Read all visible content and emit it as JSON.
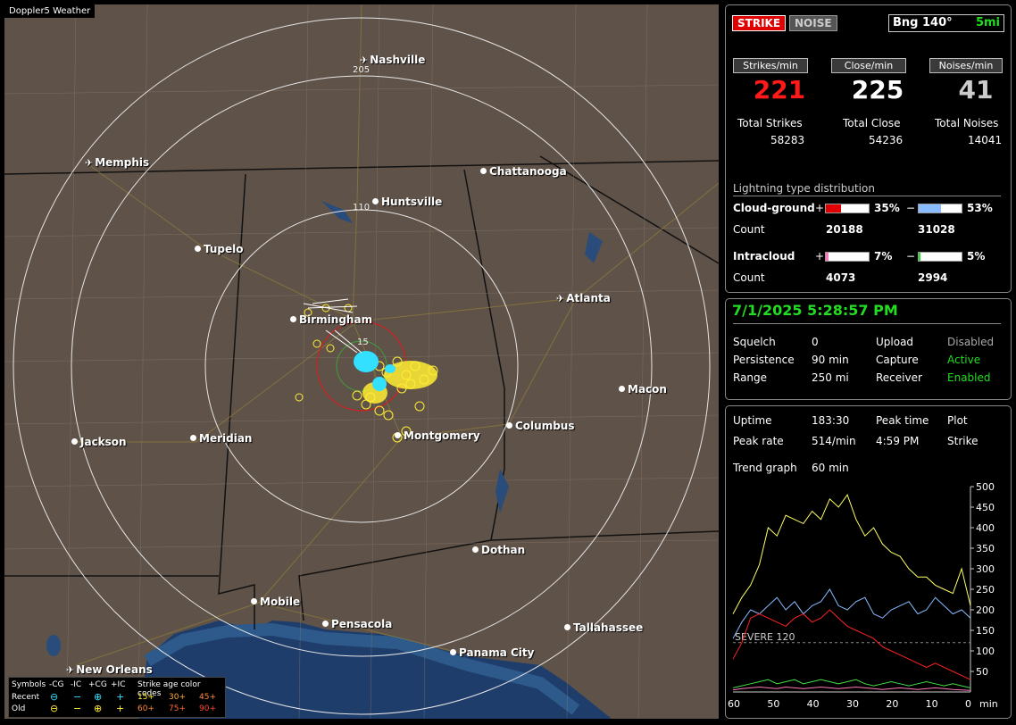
{
  "window_title": "Doppler5 Weather",
  "map": {
    "cities": [
      {
        "name": "Nashville",
        "type": "plane"
      },
      {
        "name": "Memphis",
        "type": "plane"
      },
      {
        "name": "Chattanooga",
        "type": "dot"
      },
      {
        "name": "Huntsville",
        "type": "dot"
      },
      {
        "name": "Tupelo",
        "type": "dot"
      },
      {
        "name": "Atlanta",
        "type": "plane"
      },
      {
        "name": "Birmingham",
        "type": "dot"
      },
      {
        "name": "Macon",
        "type": "dot"
      },
      {
        "name": "Jackson",
        "type": "dot"
      },
      {
        "name": "Meridian",
        "type": "dot"
      },
      {
        "name": "Montgomery",
        "type": "dot"
      },
      {
        "name": "Columbus",
        "type": "dot"
      },
      {
        "name": "Dothan",
        "type": "dot"
      },
      {
        "name": "Mobile",
        "type": "dot"
      },
      {
        "name": "Pensacola",
        "type": "dot"
      },
      {
        "name": "Tallahassee",
        "type": "dot"
      },
      {
        "name": "Panama City",
        "type": "dot"
      },
      {
        "name": "New Orleans",
        "type": "plane"
      }
    ],
    "ring_labels": [
      "205",
      "110",
      "15"
    ]
  },
  "legend": {
    "symbols_label": "Symbols",
    "cols": [
      "-CG",
      "-IC",
      "+CG",
      "+IC"
    ],
    "age_label": "Strike age color codes",
    "recent": "Recent",
    "old": "Old",
    "recent_ages": [
      "15+",
      "30+",
      "45+"
    ],
    "old_ages": [
      "60+",
      "75+",
      "90+"
    ],
    "recent_symbols": [
      "⊖",
      "−",
      "⊕",
      "+"
    ],
    "old_symbols": [
      "⊖",
      "−",
      "⊕",
      "+"
    ]
  },
  "status": {
    "strike_btn": "STRIKE",
    "noise_btn": "NOISE",
    "bearing": "Bng 140°",
    "distance": "5mi",
    "strikes_min_label": "Strikes/min",
    "close_min_label": "Close/min",
    "noises_min_label": "Noises/min",
    "strikes_min": "221",
    "close_min": "225",
    "noises_min": "41",
    "total_strikes_label": "Total Strikes",
    "total_close_label": "Total Close",
    "total_noises_label": "Total Noises",
    "total_strikes": "58283",
    "total_close": "54236",
    "total_noises": "14041",
    "dist_title": "Lightning type distribution",
    "cg_label": "Cloud-ground",
    "ic_label": "Intracloud",
    "count_label": "Count",
    "plus": "+",
    "minus": "−",
    "cg_pos_pct": "35%",
    "cg_neg_pct": "53%",
    "ic_pos_pct": "7%",
    "ic_neg_pct": "5%",
    "cg_pos_count": "20188",
    "cg_neg_count": "31028",
    "ic_pos_count": "4073",
    "ic_neg_count": "2994",
    "cg_pos_level": 0.35,
    "cg_neg_level": 0.53,
    "ic_pos_level": 0.07,
    "ic_neg_level": 0.05
  },
  "settings": {
    "datetime": "7/1/2025 5:28:57 PM",
    "squelch_label": "Squelch",
    "squelch": "0",
    "persistence_label": "Persistence",
    "persistence": "90 min",
    "range_label": "Range",
    "range": "250 mi",
    "upload_label": "Upload",
    "upload": "Disabled",
    "capture_label": "Capture",
    "capture": "Active",
    "receiver_label": "Receiver",
    "receiver": "Enabled"
  },
  "trend": {
    "uptime_label": "Uptime",
    "uptime": "183:30",
    "peak_time_label": "Peak time",
    "peak_time": "4:59 PM",
    "plot_label": "Plot",
    "plot": "Strike",
    "peak_rate_label": "Peak rate",
    "peak_rate": "514/min",
    "trend_graph_label": "Trend graph",
    "trend_graph": "60 min",
    "severe_label": "SEVERE 120",
    "x_ticks": [
      "60",
      "50",
      "40",
      "30",
      "20",
      "10",
      "0"
    ],
    "x_unit": "min",
    "y_ticks": [
      "500",
      "450",
      "400",
      "350",
      "300",
      "250",
      "200",
      "150",
      "100",
      "50"
    ]
  },
  "chart_data": {
    "type": "line",
    "xlabel": "min",
    "ylim": [
      0,
      500
    ],
    "xlim": [
      60,
      0
    ],
    "threshold": 120,
    "series": [
      {
        "color": "#ffff66",
        "values": [
          190,
          230,
          260,
          310,
          400,
          380,
          430,
          420,
          410,
          440,
          420,
          470,
          450,
          480,
          420,
          380,
          400,
          360,
          340,
          330,
          300,
          280,
          280,
          260,
          250,
          240,
          300,
          210
        ]
      },
      {
        "color": "#88bbff",
        "values": [
          130,
          170,
          200,
          190,
          210,
          230,
          200,
          220,
          190,
          210,
          220,
          250,
          210,
          200,
          220,
          230,
          190,
          180,
          200,
          210,
          220,
          190,
          200,
          230,
          210,
          190,
          200,
          180
        ]
      },
      {
        "color": "#ff2222",
        "values": [
          80,
          120,
          180,
          190,
          180,
          170,
          160,
          180,
          190,
          170,
          180,
          200,
          180,
          160,
          150,
          140,
          130,
          110,
          100,
          90,
          80,
          70,
          60,
          70,
          60,
          50,
          40,
          30
        ]
      },
      {
        "color": "#44dd44",
        "values": [
          10,
          15,
          20,
          25,
          30,
          20,
          25,
          30,
          20,
          25,
          30,
          25,
          20,
          25,
          30,
          20,
          15,
          20,
          25,
          20,
          15,
          20,
          25,
          20,
          15,
          20,
          15,
          10
        ]
      },
      {
        "color": "#ff77bb",
        "values": [
          5,
          8,
          10,
          12,
          10,
          8,
          12,
          10,
          8,
          10,
          12,
          10,
          8,
          10,
          12,
          10,
          8,
          6,
          8,
          10,
          8,
          6,
          8,
          10,
          8,
          6,
          5,
          4
        ]
      }
    ]
  }
}
